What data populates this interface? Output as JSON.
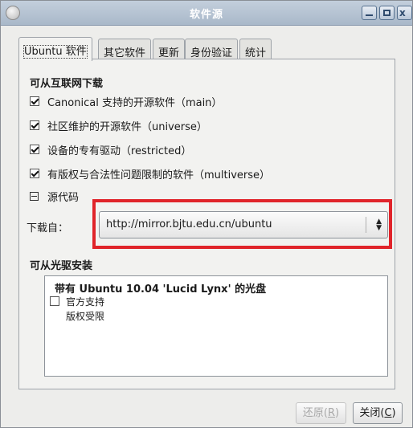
{
  "window": {
    "title": "软件源",
    "close_glyph": "x"
  },
  "tabs": [
    {
      "label": "Ubuntu 软件",
      "active": true
    },
    {
      "label": "其它软件",
      "active": false
    },
    {
      "label": "更新",
      "active": false
    },
    {
      "label": "身份验证",
      "active": false
    },
    {
      "label": "统计",
      "active": false
    }
  ],
  "internet": {
    "heading": "可从互联网下载",
    "items": [
      {
        "label": "Canonical 支持的开源软件（main）",
        "checked": true
      },
      {
        "label": "社区维护的开源软件（universe）",
        "checked": true
      },
      {
        "label": "设备的专有驱动（restricted）",
        "checked": true
      },
      {
        "label": "有版权与合法性问题限制的软件（multiverse）",
        "checked": true
      }
    ],
    "source_code_label": "源代码",
    "source_code_state": "partial",
    "download_from_label": "下载自：",
    "download_from_value": "http://mirror.bjtu.edu.cn/ubuntu"
  },
  "cdrom": {
    "heading": "可从光驱安装",
    "entry_title": "带有  Ubuntu 10.04 'Lucid Lynx' 的光盘",
    "entry_line1": "官方支持",
    "entry_line2": "版权受限",
    "checked": false
  },
  "buttons": {
    "revert_text": "还原(",
    "revert_key": "R",
    "revert_end": ")",
    "revert_enabled": false,
    "close_text": "关闭(",
    "close_key": "C",
    "close_end": ")"
  },
  "colors": {
    "highlight_box": "#e0242a",
    "titlebar": "#a9b8c9"
  }
}
